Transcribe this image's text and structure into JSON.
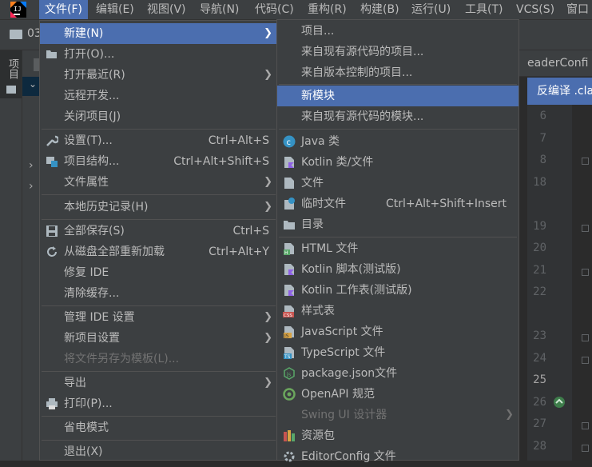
{
  "menubar": {
    "items": [
      "文件(F)",
      "编辑(E)",
      "视图(V)",
      "导航(N)",
      "代码(C)",
      "重构(R)",
      "构建(B)",
      "运行(U)",
      "工具(T)",
      "VCS(S)",
      "窗口"
    ]
  },
  "toolbar": {
    "project_label": "03"
  },
  "sidebar": {
    "project_tab": "项目"
  },
  "editor": {
    "tab_label": "eaderConfi",
    "decompile_bar": "反编译 .cla",
    "line_numbers": [
      "6",
      "7",
      "8",
      "18",
      "19",
      "20",
      "21",
      "22",
      "23",
      "24",
      "25",
      "26",
      "27",
      "28"
    ],
    "current_line": "25"
  },
  "file_menu": {
    "items": [
      {
        "label": "新建(N)",
        "shortcut": "",
        "submenu": true
      },
      {
        "label": "打开(O)...",
        "shortcut": "",
        "icon": "folder-open-icon"
      },
      {
        "label": "打开最近(R)",
        "shortcut": "",
        "submenu": true
      },
      {
        "label": "远程开发...",
        "shortcut": ""
      },
      {
        "label": "关闭项目(J)",
        "shortcut": ""
      },
      {
        "label": "设置(T)...",
        "shortcut": "Ctrl+Alt+S",
        "icon": "wrench-icon"
      },
      {
        "label": "项目结构...",
        "shortcut": "Ctrl+Alt+Shift+S",
        "icon": "project-structure-icon"
      },
      {
        "label": "文件属性",
        "shortcut": "",
        "submenu": true
      },
      {
        "label": "本地历史记录(H)",
        "shortcut": "",
        "submenu": true
      },
      {
        "label": "全部保存(S)",
        "shortcut": "Ctrl+S",
        "icon": "save-icon"
      },
      {
        "label": "从磁盘全部重新加载",
        "shortcut": "Ctrl+Alt+Y",
        "icon": "reload-icon"
      },
      {
        "label": "修复 IDE",
        "shortcut": ""
      },
      {
        "label": "清除缓存...",
        "shortcut": ""
      },
      {
        "label": "管理 IDE 设置",
        "shortcut": "",
        "submenu": true
      },
      {
        "label": "新项目设置",
        "shortcut": "",
        "submenu": true
      },
      {
        "label": "将文件另存为模板(L)...",
        "shortcut": "",
        "disabled": true
      },
      {
        "label": "导出",
        "shortcut": "",
        "submenu": true
      },
      {
        "label": "打印(P)...",
        "shortcut": "",
        "icon": "print-icon"
      },
      {
        "label": "省电模式",
        "shortcut": ""
      },
      {
        "label": "退出(X)",
        "shortcut": ""
      }
    ]
  },
  "new_submenu": {
    "items": [
      {
        "label": "项目...",
        "shortcut": ""
      },
      {
        "label": "来自现有源代码的项目...",
        "shortcut": ""
      },
      {
        "label": "来自版本控制的项目...",
        "shortcut": ""
      },
      {
        "label": "新模块",
        "shortcut": ""
      },
      {
        "label": "来自现有源代码的模块...",
        "shortcut": ""
      },
      {
        "label": "Java 类",
        "shortcut": "",
        "icon": "java-class-icon"
      },
      {
        "label": "Kotlin 类/文件",
        "shortcut": "",
        "icon": "kotlin-file-icon"
      },
      {
        "label": "文件",
        "shortcut": "",
        "icon": "file-icon"
      },
      {
        "label": "临时文件",
        "shortcut": "Ctrl+Alt+Shift+Insert",
        "icon": "scratch-file-icon"
      },
      {
        "label": "目录",
        "shortcut": "",
        "icon": "directory-icon"
      },
      {
        "label": "HTML 文件",
        "shortcut": "",
        "icon": "html-file-icon"
      },
      {
        "label": "Kotlin 脚本(测试版)",
        "shortcut": "",
        "icon": "kotlin-script-icon"
      },
      {
        "label": "Kotlin 工作表(测试版)",
        "shortcut": "",
        "icon": "kotlin-worksheet-icon"
      },
      {
        "label": "样式表",
        "shortcut": "",
        "icon": "css-file-icon"
      },
      {
        "label": "JavaScript 文件",
        "shortcut": "",
        "icon": "javascript-file-icon"
      },
      {
        "label": "TypeScript 文件",
        "shortcut": "",
        "icon": "typescript-file-icon"
      },
      {
        "label": "package.json文件",
        "shortcut": "",
        "icon": "nodejs-icon"
      },
      {
        "label": "OpenAPI 规范",
        "shortcut": "",
        "icon": "openapi-icon"
      },
      {
        "label": "Swing UI 设计器",
        "shortcut": "",
        "submenu": true,
        "disabled": true
      },
      {
        "label": "资源包",
        "shortcut": "",
        "icon": "resource-bundle-icon"
      },
      {
        "label": "EditorConfig 文件",
        "shortcut": "",
        "icon": "editorconfig-icon"
      }
    ]
  },
  "colors": {
    "menu_bg": "#3c3f41",
    "highlight": "#4b6eaf",
    "text": "#bbbbbb",
    "disabled_text": "#727272",
    "separator": "#515151"
  }
}
